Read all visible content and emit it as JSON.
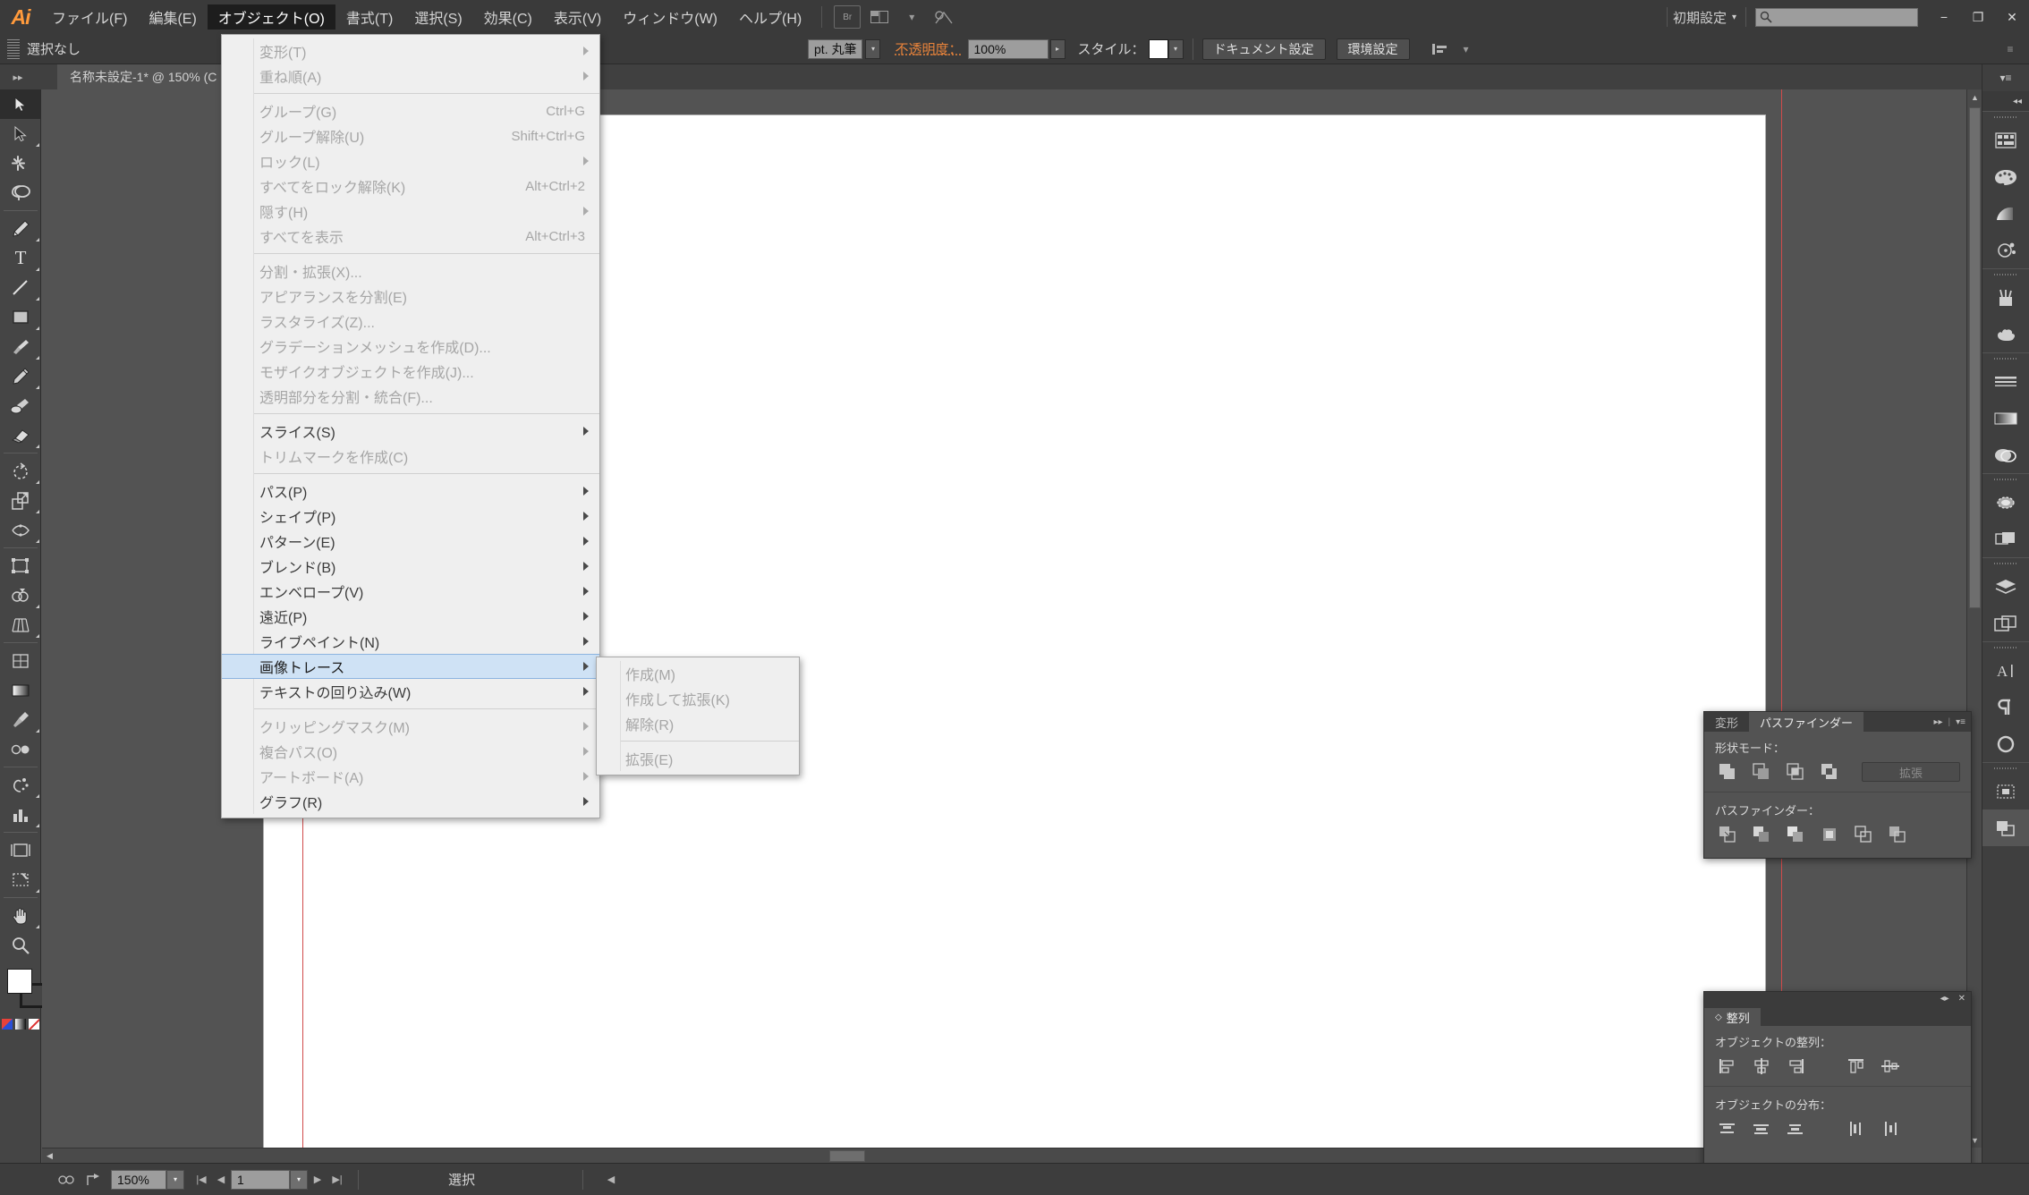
{
  "app": {
    "logo": "Ai"
  },
  "menubar": {
    "items": [
      {
        "label": "ファイル(F)",
        "active": false
      },
      {
        "label": "編集(E)",
        "active": false
      },
      {
        "label": "オブジェクト(O)",
        "active": true
      },
      {
        "label": "書式(T)",
        "active": false
      },
      {
        "label": "選択(S)",
        "active": false
      },
      {
        "label": "効果(C)",
        "active": false
      },
      {
        "label": "表示(V)",
        "active": false
      },
      {
        "label": "ウィンドウ(W)",
        "active": false
      },
      {
        "label": "ヘルプ(H)",
        "active": false
      }
    ],
    "bridge_icon": "br-icon",
    "arrange_icon": "arrange-documents-icon",
    "stock_icon": "stock-icon",
    "workspace": "初期設定",
    "search_placeholder": "",
    "search_value": "",
    "window_minimize": "−",
    "window_restore": "❐",
    "window_close": "✕"
  },
  "controlbar": {
    "selection_label": "選択なし",
    "fill_swatch_color": "#ffffff",
    "stroke_weight_suffix": "pt. 丸筆",
    "opacity_label": "不透明度：",
    "opacity_value": "100%",
    "style_label": "スタイル：",
    "style_swatch_color": "#ffffff",
    "document_setup": "ドキュメント設定",
    "preferences": "環境設定",
    "align_icon": "align-icon"
  },
  "document": {
    "tab_title": "名称未設定-1* @ 150% (C",
    "collapse_icon": "expand-arrows-icon"
  },
  "toolbar": {
    "tools": [
      {
        "name": "selection-tool",
        "glyph": "arrow-white",
        "selected": true,
        "flyout": false
      },
      {
        "name": "direct-selection-tool",
        "glyph": "arrow-black",
        "selected": false,
        "flyout": true
      },
      {
        "name": "magic-wand-tool",
        "glyph": "wand",
        "selected": false,
        "flyout": false
      },
      {
        "name": "lasso-tool",
        "glyph": "lasso",
        "selected": false,
        "flyout": false
      },
      {
        "name": "pen-tool",
        "glyph": "pen",
        "selected": false,
        "flyout": true
      },
      {
        "name": "type-tool",
        "glyph": "T",
        "selected": false,
        "flyout": true
      },
      {
        "name": "line-segment-tool",
        "glyph": "line",
        "selected": false,
        "flyout": true
      },
      {
        "name": "rectangle-tool",
        "glyph": "rect",
        "selected": false,
        "flyout": true
      },
      {
        "name": "paintbrush-tool",
        "glyph": "brush",
        "selected": false,
        "flyout": true
      },
      {
        "name": "pencil-tool",
        "glyph": "pencil",
        "selected": false,
        "flyout": true
      },
      {
        "name": "blob-brush-tool",
        "glyph": "blob",
        "selected": false,
        "flyout": false
      },
      {
        "name": "eraser-tool",
        "glyph": "eraser",
        "selected": false,
        "flyout": true
      },
      {
        "name": "rotate-tool",
        "glyph": "rotate",
        "selected": false,
        "flyout": true
      },
      {
        "name": "scale-tool",
        "glyph": "scale",
        "selected": false,
        "flyout": true
      },
      {
        "name": "width-tool",
        "glyph": "width",
        "selected": false,
        "flyout": true
      },
      {
        "name": "free-transform-tool",
        "glyph": "freetransform",
        "selected": false,
        "flyout": false
      },
      {
        "name": "shape-builder-tool",
        "glyph": "shapebuilder",
        "selected": false,
        "flyout": true
      },
      {
        "name": "perspective-grid-tool",
        "glyph": "perspective",
        "selected": false,
        "flyout": true
      },
      {
        "name": "mesh-tool",
        "glyph": "mesh",
        "selected": false,
        "flyout": false
      },
      {
        "name": "gradient-tool",
        "glyph": "gradient",
        "selected": false,
        "flyout": false
      },
      {
        "name": "eyedropper-tool",
        "glyph": "eyedropper",
        "selected": false,
        "flyout": true
      },
      {
        "name": "blend-tool",
        "glyph": "blend",
        "selected": false,
        "flyout": false
      },
      {
        "name": "symbol-sprayer-tool",
        "glyph": "symbol",
        "selected": false,
        "flyout": true
      },
      {
        "name": "column-graph-tool",
        "glyph": "graph",
        "selected": false,
        "flyout": true
      },
      {
        "name": "artboard-tool",
        "glyph": "artboard",
        "selected": false,
        "flyout": false
      },
      {
        "name": "slice-tool",
        "glyph": "slice",
        "selected": false,
        "flyout": true
      },
      {
        "name": "hand-tool",
        "glyph": "hand",
        "selected": false,
        "flyout": true
      },
      {
        "name": "zoom-tool",
        "glyph": "zoom",
        "selected": false,
        "flyout": false
      }
    ],
    "fill_color": "#ffffff",
    "stroke_color": "#1c1c1c"
  },
  "object_menu": {
    "items": [
      {
        "label": "変形(T)",
        "shortcut": "",
        "submenu": true,
        "disabled": true,
        "highlight": false
      },
      {
        "label": "重ね順(A)",
        "shortcut": "",
        "submenu": true,
        "disabled": true,
        "highlight": false
      },
      {
        "separator": true
      },
      {
        "label": "グループ(G)",
        "shortcut": "Ctrl+G",
        "submenu": false,
        "disabled": true,
        "highlight": false
      },
      {
        "label": "グループ解除(U)",
        "shortcut": "Shift+Ctrl+G",
        "submenu": false,
        "disabled": true,
        "highlight": false
      },
      {
        "label": "ロック(L)",
        "shortcut": "",
        "submenu": true,
        "disabled": true,
        "highlight": false
      },
      {
        "label": "すべてをロック解除(K)",
        "shortcut": "Alt+Ctrl+2",
        "submenu": false,
        "disabled": true,
        "highlight": false
      },
      {
        "label": "隠す(H)",
        "shortcut": "",
        "submenu": true,
        "disabled": true,
        "highlight": false
      },
      {
        "label": "すべてを表示",
        "shortcut": "Alt+Ctrl+3",
        "submenu": false,
        "disabled": true,
        "highlight": false
      },
      {
        "separator": true
      },
      {
        "label": "分割・拡張(X)...",
        "shortcut": "",
        "submenu": false,
        "disabled": true,
        "highlight": false
      },
      {
        "label": "アピアランスを分割(E)",
        "shortcut": "",
        "submenu": false,
        "disabled": true,
        "highlight": false
      },
      {
        "label": "ラスタライズ(Z)...",
        "shortcut": "",
        "submenu": false,
        "disabled": true,
        "highlight": false
      },
      {
        "label": "グラデーションメッシュを作成(D)...",
        "shortcut": "",
        "submenu": false,
        "disabled": true,
        "highlight": false
      },
      {
        "label": "モザイクオブジェクトを作成(J)...",
        "shortcut": "",
        "submenu": false,
        "disabled": true,
        "highlight": false
      },
      {
        "label": "透明部分を分割・統合(F)...",
        "shortcut": "",
        "submenu": false,
        "disabled": true,
        "highlight": false
      },
      {
        "separator": true
      },
      {
        "label": "スライス(S)",
        "shortcut": "",
        "submenu": true,
        "disabled": false,
        "highlight": false
      },
      {
        "label": "トリムマークを作成(C)",
        "shortcut": "",
        "submenu": false,
        "disabled": true,
        "highlight": false
      },
      {
        "separator": true
      },
      {
        "label": "パス(P)",
        "shortcut": "",
        "submenu": true,
        "disabled": false,
        "highlight": false
      },
      {
        "label": "シェイプ(P)",
        "shortcut": "",
        "submenu": true,
        "disabled": false,
        "highlight": false
      },
      {
        "label": "パターン(E)",
        "shortcut": "",
        "submenu": true,
        "disabled": false,
        "highlight": false
      },
      {
        "label": "ブレンド(B)",
        "shortcut": "",
        "submenu": true,
        "disabled": false,
        "highlight": false
      },
      {
        "label": "エンベロープ(V)",
        "shortcut": "",
        "submenu": true,
        "disabled": false,
        "highlight": false
      },
      {
        "label": "遠近(P)",
        "shortcut": "",
        "submenu": true,
        "disabled": false,
        "highlight": false
      },
      {
        "label": "ライブペイント(N)",
        "shortcut": "",
        "submenu": true,
        "disabled": false,
        "highlight": false
      },
      {
        "label": "画像トレース",
        "shortcut": "",
        "submenu": true,
        "disabled": false,
        "highlight": true
      },
      {
        "label": "テキストの回り込み(W)",
        "shortcut": "",
        "submenu": true,
        "disabled": false,
        "highlight": false
      },
      {
        "separator": true
      },
      {
        "label": "クリッピングマスク(M)",
        "shortcut": "",
        "submenu": true,
        "disabled": true,
        "highlight": false
      },
      {
        "label": "複合パス(O)",
        "shortcut": "",
        "submenu": true,
        "disabled": true,
        "highlight": false
      },
      {
        "label": "アートボード(A)",
        "shortcut": "",
        "submenu": true,
        "disabled": true,
        "highlight": false
      },
      {
        "label": "グラフ(R)",
        "shortcut": "",
        "submenu": true,
        "disabled": false,
        "highlight": false
      }
    ]
  },
  "image_trace_submenu": {
    "items": [
      {
        "label": "作成(M)",
        "disabled": true
      },
      {
        "label": "作成して拡張(K)",
        "disabled": true
      },
      {
        "label": "解除(R)",
        "disabled": true
      },
      {
        "separator": true
      },
      {
        "label": "拡張(E)",
        "disabled": true
      }
    ]
  },
  "pathfinder_panel": {
    "tabs": [
      {
        "label": "変形",
        "active": false
      },
      {
        "label": "パスファインダー",
        "active": true
      }
    ],
    "shape_modes_label": "形状モード：",
    "expand_button": "拡張",
    "pathfinders_label": "パスファインダー：",
    "shape_mode_icons": [
      "unite-icon",
      "minus-front-icon",
      "intersect-icon",
      "exclude-icon"
    ],
    "pathfinder_icons": [
      "divide-icon",
      "trim-icon",
      "merge-icon",
      "crop-icon",
      "outline-icon",
      "minus-back-icon"
    ],
    "menu_icon": "panel-menu-icon",
    "collapse_icon": "double-arrow-icon"
  },
  "align_panel": {
    "tab_label": "整列",
    "align_objects_label": "オブジェクトの整列：",
    "distribute_objects_label": "オブジェクトの分布：",
    "align_icons": [
      "align-left-icon",
      "align-horizontal-center-icon",
      "align-right-icon",
      "align-top-icon",
      "align-vertical-center-icon"
    ],
    "distribute_icons": [
      "distribute-top-icon",
      "distribute-vertical-center-icon",
      "distribute-bottom-icon",
      "distribute-left-icon",
      "distribute-horizontal-center-icon"
    ],
    "collapse_icon": "collapse-icon",
    "close_icon": "close-icon"
  },
  "dock": {
    "groups": [
      {
        "icons": [
          "color-guide-icon",
          "color-icon",
          "gradient-icon",
          "color-themes-icon"
        ]
      },
      {
        "icons": [
          "brushes-icon",
          "symbols-icon"
        ]
      },
      {
        "icons": [
          "stroke-icon",
          "gradient-panel-icon",
          "transparency-icon"
        ]
      },
      {
        "icons": [
          "appearance-icon",
          "graphic-styles-icon"
        ]
      },
      {
        "icons": [
          "layers-icon",
          "artboards-icon"
        ]
      },
      {
        "icons": [
          "character-icon",
          "paragraph-icon",
          "opentype-icon"
        ]
      },
      {
        "icons": [
          "transform-icon",
          "pathfinder-dock-icon"
        ]
      }
    ],
    "menu_icon": "dock-menu-icon",
    "collapse_icon": "dock-collapse-icon"
  },
  "statusbar": {
    "artboard_nav_icon": "artboard-nav-icon",
    "share_icon": "share-on-behance-icon",
    "zoom_value": "150%",
    "page_value": "1",
    "first_icon": "first-page-icon",
    "prev_icon": "prev-page-icon",
    "next_icon": "next-page-icon",
    "last_icon": "last-page-icon",
    "status_text": "選択"
  }
}
